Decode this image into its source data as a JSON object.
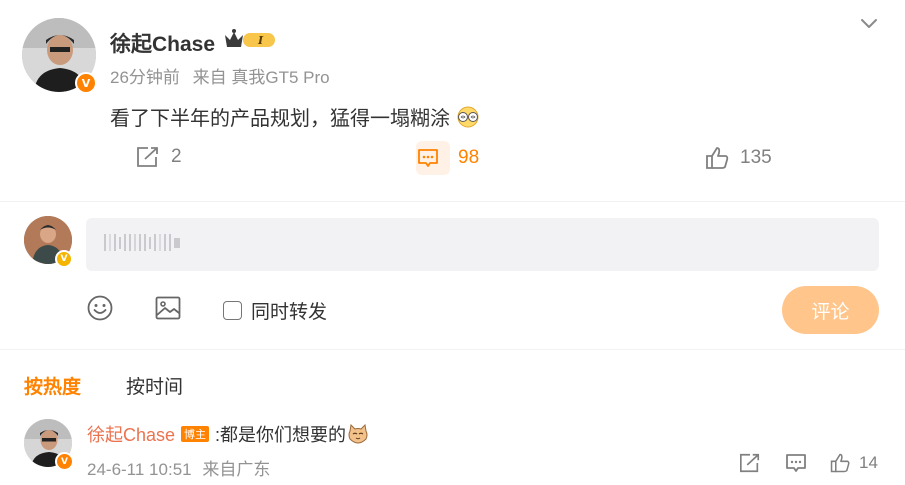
{
  "post": {
    "author": "徐起Chase",
    "crown_level": "I",
    "time": "26分钟前",
    "source": "来自 真我GT5 Pro",
    "text": "看了下半年的产品规划，猛得一塌糊涂",
    "repost_count": "2",
    "comment_count": "98",
    "like_count": "135"
  },
  "composer": {
    "placeholder": "",
    "repost_label": "同时转发",
    "submit_label": "评论"
  },
  "sort": {
    "hot_label": "按热度",
    "time_label": "按时间"
  },
  "comments": [
    {
      "author": "徐起Chase",
      "tag": "博主",
      "text": ":都是你们想要的",
      "time": "24-6-11 10:51",
      "location": "来自广东",
      "like_count": "14"
    }
  ],
  "colors": {
    "accent": "#ff8200",
    "name_link": "#eb7350",
    "submit_disabled": "#ffc58a"
  }
}
